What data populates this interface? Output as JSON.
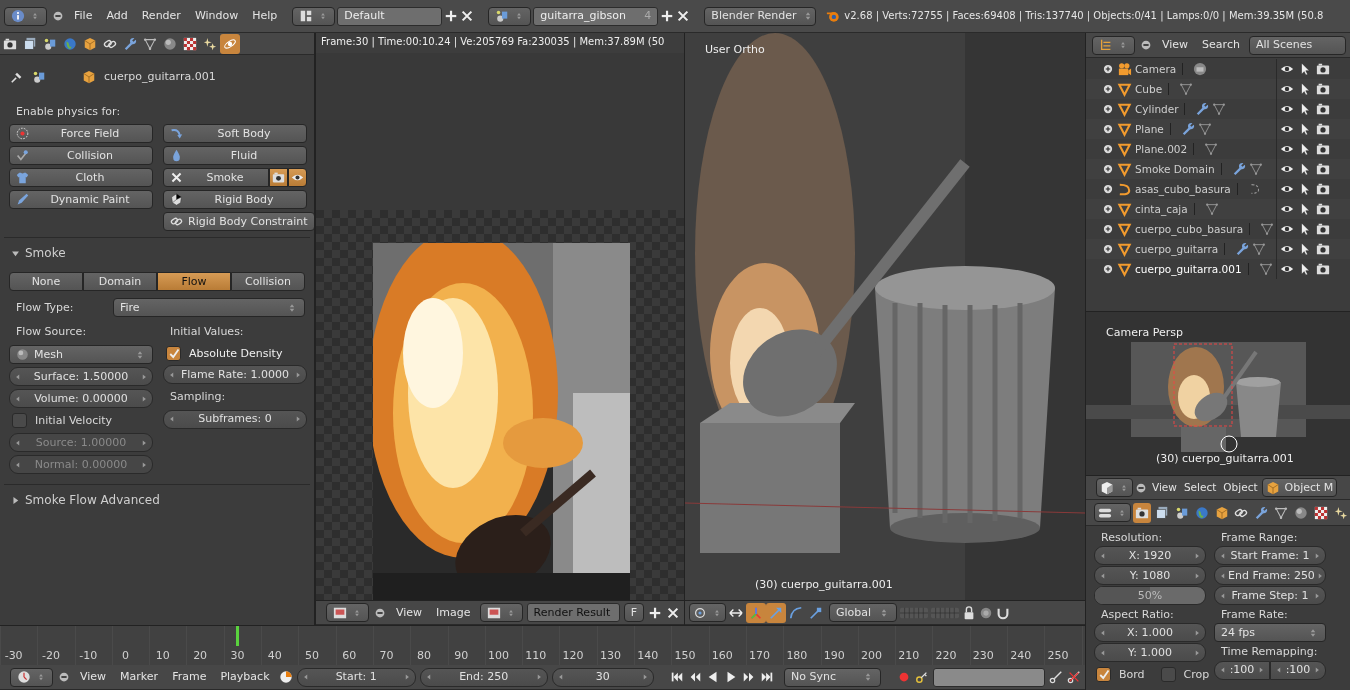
{
  "top_bar": {
    "menus": [
      "File",
      "Add",
      "Render",
      "Window",
      "Help"
    ],
    "layout": "Default",
    "scene": "guitarra_gibson",
    "scene_users": "4",
    "engine": "Blender Render",
    "stats": "v2.68 | Verts:72755 | Faces:69408 | Tris:137740 | Objects:0/41 | Lamps:0/0 | Mem:39.35M (50.8"
  },
  "physics_tabs": [
    {
      "kind": "render",
      "selected": false
    },
    {
      "kind": "layers",
      "selected": false
    },
    {
      "kind": "scene",
      "selected": false
    },
    {
      "kind": "world",
      "selected": false
    },
    {
      "kind": "object",
      "selected": false
    },
    {
      "kind": "constraint",
      "selected": false
    },
    {
      "kind": "modifier",
      "selected": false
    },
    {
      "kind": "data",
      "selected": false
    },
    {
      "kind": "material",
      "selected": false
    },
    {
      "kind": "texture",
      "selected": false
    },
    {
      "kind": "particles",
      "selected": false
    },
    {
      "kind": "physics",
      "selected": true
    }
  ],
  "physics_panel": {
    "object": "cuerpo_guitarra.001",
    "heading": "Enable physics for:",
    "buttons": [
      {
        "label": "Force Field",
        "kind": "force",
        "enabled": false
      },
      {
        "label": "Soft Body",
        "kind": "softbody",
        "enabled": false
      },
      {
        "label": "Collision",
        "kind": "collision",
        "enabled": false
      },
      {
        "label": "Fluid",
        "kind": "fluid",
        "enabled": false
      },
      {
        "label": "Cloth",
        "kind": "cloth",
        "enabled": false
      },
      {
        "label": "Smoke",
        "kind": "smoke",
        "enabled": true
      },
      {
        "label": "Dynamic Paint",
        "kind": "paint",
        "enabled": false
      },
      {
        "label": "Rigid Body",
        "kind": "rigid",
        "enabled": false
      },
      {
        "label": "Rigid Body Constraint",
        "kind": "constraint",
        "enabled": false
      }
    ]
  },
  "smoke_panel": {
    "title": "Smoke",
    "expanded": true,
    "types": [
      {
        "label": "None",
        "selected": false
      },
      {
        "label": "Domain",
        "selected": false
      },
      {
        "label": "Flow",
        "selected": true
      },
      {
        "label": "Collision",
        "selected": false
      }
    ],
    "flow_type_label": "Flow Type:",
    "flow_type": "Fire",
    "flow_source_label": "Flow Source:",
    "flow_source": "Mesh",
    "surface": "Surface: 1.50000",
    "volume": "Volume: 0.00000",
    "initial_velocity": {
      "label": "Initial Velocity",
      "checked": false
    },
    "source": "Source: 1.00000",
    "normal": "Normal: 0.00000",
    "initial_values_label": "Initial Values:",
    "absolute_density": {
      "label": "Absolute Density",
      "checked": true
    },
    "flame_rate": "Flame Rate: 1.0000",
    "sampling_label": "Sampling:",
    "subframes": "Subframes: 0"
  },
  "advanced_panel": {
    "title": "Smoke Flow Advanced",
    "expanded": false
  },
  "image_editor": {
    "info": "Frame:30 | Time:00:10.24 | Ve:205769 Fa:230035 | Mem:37.89M (50",
    "menus": [
      "View",
      "Image"
    ],
    "image": "Render Result",
    "fake_user": "F"
  },
  "viewport": {
    "title": "User Ortho",
    "object_label": "(30) cuerpo_guitarra.001",
    "transform": "Global",
    "tools": [
      {
        "kind": "manipulator",
        "on": true
      },
      {
        "kind": "translate",
        "on": true
      },
      {
        "kind": "rotate",
        "on": false
      },
      {
        "kind": "scale",
        "on": false
      }
    ]
  },
  "timeline": {
    "ticks": [
      "-30",
      "-20",
      "-10",
      "0",
      "10",
      "20",
      "30",
      "40",
      "50",
      "60",
      "70",
      "80",
      "90",
      "100",
      "110",
      "120",
      "130",
      "140",
      "150",
      "160",
      "170",
      "180",
      "190",
      "200",
      "210",
      "220",
      "230",
      "240",
      "250"
    ],
    "playhead": {
      "level": 0.2143
    },
    "menus": [
      "View",
      "Marker",
      "Frame",
      "Playback"
    ],
    "start": "Start: 1",
    "end": "End: 250",
    "current": "30",
    "sync": "No Sync"
  },
  "outliner": {
    "menus": [
      "View",
      "Search"
    ],
    "filter": "All Scenes",
    "items": [
      {
        "name": "Camera",
        "kind": "camera",
        "modifier": false,
        "selected": false
      },
      {
        "name": "Cube",
        "kind": "mesh",
        "modifier": false,
        "selected": false
      },
      {
        "name": "Cylinder",
        "kind": "mesh",
        "modifier": true,
        "selected": false
      },
      {
        "name": "Plane",
        "kind": "mesh",
        "modifier": true,
        "selected": false
      },
      {
        "name": "Plane.002",
        "kind": "mesh",
        "modifier": false,
        "selected": false
      },
      {
        "name": "Smoke Domain",
        "kind": "mesh",
        "modifier": true,
        "selected": false
      },
      {
        "name": "asas_cubo_basura",
        "kind": "curve",
        "modifier": false,
        "selected": false
      },
      {
        "name": "cinta_caja",
        "kind": "mesh",
        "modifier": false,
        "selected": false
      },
      {
        "name": "cuerpo_cubo_basura",
        "kind": "mesh",
        "modifier": false,
        "selected": false
      },
      {
        "name": "cuerpo_guitarra",
        "kind": "mesh",
        "modifier": true,
        "selected": false
      },
      {
        "name": "cuerpo_guitarra.001",
        "kind": "mesh",
        "modifier": false,
        "selected": true
      }
    ]
  },
  "camera_view": {
    "title": "Camera Persp",
    "object_label": "(30) cuerpo_guitarra.001"
  },
  "view3d_header": {
    "menus": [
      "View",
      "Select",
      "Object"
    ],
    "mode": "Object M"
  },
  "render_tabs": [
    {
      "kind": "render",
      "selected": true
    },
    {
      "kind": "layers",
      "selected": false
    },
    {
      "kind": "scene",
      "selected": false
    },
    {
      "kind": "world",
      "selected": false
    },
    {
      "kind": "object",
      "selected": false
    },
    {
      "kind": "constraint",
      "selected": false
    },
    {
      "kind": "modifier",
      "selected": false
    },
    {
      "kind": "data",
      "selected": false
    },
    {
      "kind": "material",
      "selected": false
    },
    {
      "kind": "texture",
      "selected": false
    },
    {
      "kind": "particles",
      "selected": false
    }
  ],
  "render_props": {
    "resolution_label": "Resolution:",
    "res_x": "X: 1920",
    "res_y": "Y: 1080",
    "percentage": {
      "label": "50%",
      "level": 0.5
    },
    "aspect_label": "Aspect Ratio:",
    "aspect_x": "X: 1.000",
    "aspect_y": "Y: 1.000",
    "border": {
      "label": "Bord",
      "checked": true
    },
    "crop": {
      "label": "Crop",
      "checked": false
    },
    "frame_range_label": "Frame Range:",
    "start_frame": "Start Frame: 1",
    "end_frame": "End Frame: 250",
    "frame_step": "Frame Step: 1",
    "frame_rate_label": "Frame Rate:",
    "frame_rate": "24 fps",
    "time_remap_label": "Time Remapping:",
    "remap_old": ":100",
    "remap_new": ":100"
  }
}
